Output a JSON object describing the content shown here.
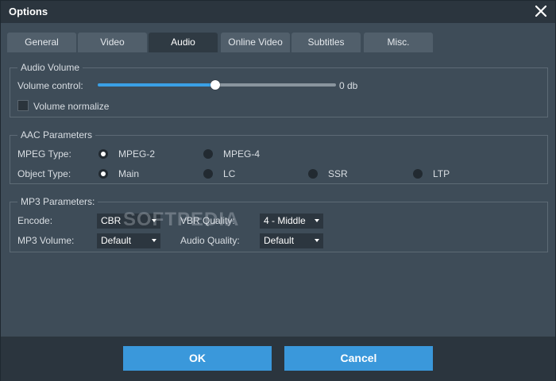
{
  "window": {
    "title": "Options"
  },
  "tabs": [
    {
      "label": "General"
    },
    {
      "label": "Video"
    },
    {
      "label": "Audio"
    },
    {
      "label": "Online Video"
    },
    {
      "label": "Subtitles"
    },
    {
      "label": "Misc."
    }
  ],
  "active_tab": "Audio",
  "audio_volume": {
    "legend": "Audio Volume",
    "volume_label": "Volume control:",
    "volume_value": "0 db",
    "volume_level_fraction": 0.5,
    "normalize_label": "Volume normalize",
    "normalize_checked": false
  },
  "aac": {
    "legend": "AAC Parameters",
    "mpeg_type_label": "MPEG Type:",
    "mpeg_type_options": [
      "MPEG-2",
      "MPEG-4"
    ],
    "mpeg_type_selected": "MPEG-2",
    "object_type_label": "Object Type:",
    "object_type_options": [
      "Main",
      "LC",
      "SSR",
      "LTP"
    ],
    "object_type_selected": "Main"
  },
  "mp3": {
    "legend": "MP3 Parameters:",
    "encode_label": "Encode:",
    "encode_value": "CBR",
    "vbr_quality_label": "VBR Quality:",
    "vbr_quality_value": "4 - Middle",
    "mp3_volume_label": "MP3 Volume:",
    "mp3_volume_value": "Default",
    "audio_quality_label": "Audio Quality:",
    "audio_quality_value": "Default"
  },
  "watermark": "SOFTPEDIA",
  "buttons": {
    "ok": "OK",
    "cancel": "Cancel"
  },
  "colors": {
    "accent": "#3a98db",
    "background": "#3e4c58",
    "titlebar": "#2b353e"
  }
}
